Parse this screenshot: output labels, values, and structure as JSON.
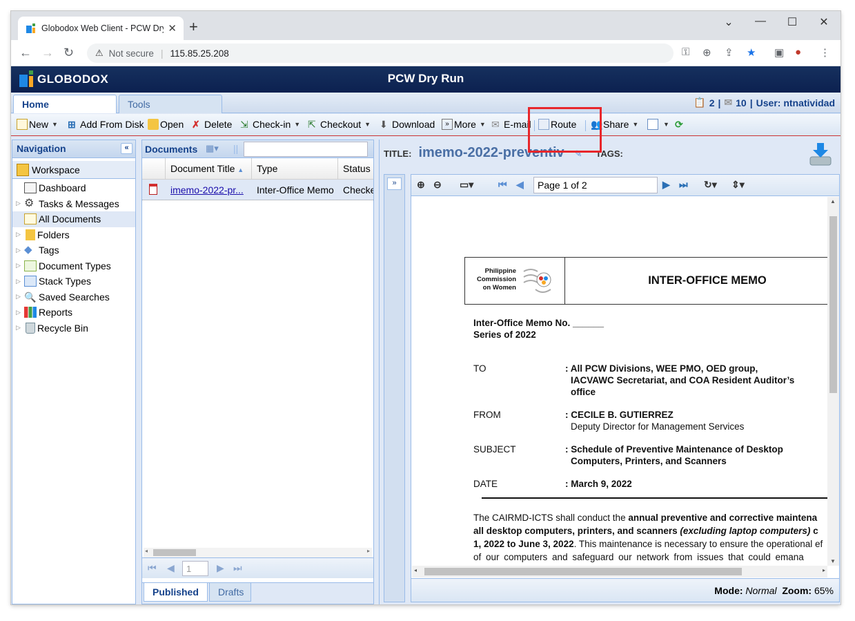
{
  "browser": {
    "tab_title": "Globodox Web Client - PCW Dry",
    "not_secure": "Not secure",
    "url": "115.85.25.208"
  },
  "app": {
    "logo_text": "GLOBODOX",
    "page_title": "PCW Dry Run",
    "tabs": [
      "Home",
      "Tools"
    ],
    "user_info": {
      "tasks_count": "2",
      "messages_count": "10",
      "user_label": "User: ntnatividad"
    }
  },
  "toolbar": {
    "new": "New",
    "add_from_disk": "Add From Disk",
    "open": "Open",
    "delete": "Delete",
    "checkin": "Check-in",
    "checkout": "Checkout",
    "download": "Download",
    "more": "More",
    "email": "E-mail",
    "route": "Route",
    "share": "Share"
  },
  "navigation": {
    "title": "Navigation",
    "workspace": "Workspace",
    "items": [
      {
        "label": "Dashboard"
      },
      {
        "label": "Tasks & Messages"
      },
      {
        "label": "All Documents"
      },
      {
        "label": "Folders"
      },
      {
        "label": "Tags"
      },
      {
        "label": "Document Types"
      },
      {
        "label": "Stack Types"
      },
      {
        "label": "Saved Searches"
      },
      {
        "label": "Reports"
      },
      {
        "label": "Recycle Bin"
      }
    ]
  },
  "documents": {
    "title": "Documents",
    "columns": [
      "Document Title",
      "Type",
      "Status"
    ],
    "rows": [
      {
        "title": "imemo-2022-pr...",
        "type": "Inter-Office Memo",
        "status": "Checke"
      }
    ],
    "page_value": "1",
    "bottom_tabs": [
      "Published",
      "Drafts"
    ]
  },
  "viewer": {
    "title_label": "TITLE:",
    "title_value": "imemo-2022-preventiv",
    "tags_label": "TAGS:",
    "page_label": "Page 1 of 2",
    "mode_label": "Mode:",
    "mode_value": "Normal",
    "zoom_label": "Zoom:",
    "zoom_value": "65%"
  },
  "memo": {
    "org_line1": "Philippine",
    "org_line2": "Commission",
    "org_line3": "on Women",
    "heading": "INTER-OFFICE MEMO",
    "memo_no": "Inter-Office Memo No. ______",
    "series": "Series of 2022",
    "to_label": "TO",
    "to_value1": ": All PCW Divisions, WEE PMO, OED group,",
    "to_value2": "IACVAWC Secretariat, and COA Resident Auditor’s",
    "to_value3": "office",
    "from_label": "FROM",
    "from_value1": ": CECILE B. GUTIERREZ",
    "from_value2": "Deputy Director for Management Services",
    "subject_label": "SUBJECT",
    "subject_value1": ": Schedule of Preventive Maintenance of Desktop",
    "subject_value2": "Computers,  Printers, and Scanners",
    "date_label": "DATE",
    "date_value": ": March 9, 2022",
    "body_l1a": "The CAIRMD-ICTS shall conduct the ",
    "body_l1b": "annual preventive and corrective maintena",
    "body_l2a": "all desktop computers, printers, and scanners ",
    "body_l2b": "(excluding laptop computers)",
    "body_l2c": " c",
    "body_l3a": "1, 2022 to June 3, 2022",
    "body_l3b": ". This maintenance is necessary to ensure the operational ef",
    "body_l4": "of our computers and safeguard our network from issues that could emana"
  }
}
